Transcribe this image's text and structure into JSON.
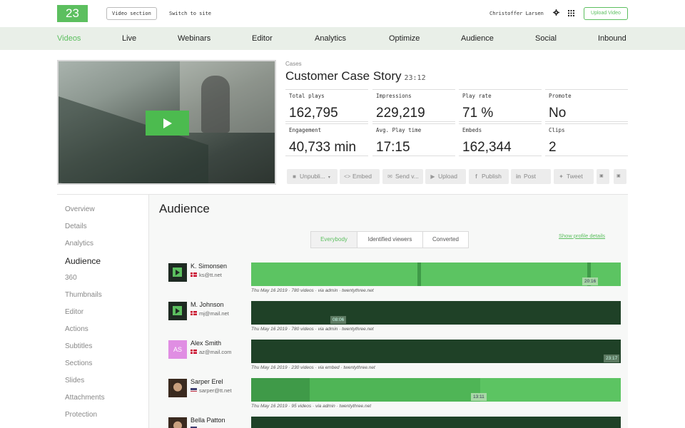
{
  "header": {
    "logo": "23",
    "video_section_label": "Video section",
    "switch_label": "Switch to site",
    "user_name": "Christoffer Larsen",
    "upload_label": "Upload Video"
  },
  "nav": {
    "items": [
      "Videos",
      "Live",
      "Webinars",
      "Editor",
      "Analytics",
      "Optimize",
      "Audience",
      "Social",
      "Inbound"
    ],
    "active": "Videos"
  },
  "video": {
    "category": "Cases",
    "title": "Customer Case Story",
    "duration": "23:12"
  },
  "stats": [
    {
      "label": "Total plays",
      "value": "162,795"
    },
    {
      "label": "Impressions",
      "value": "229,219"
    },
    {
      "label": "Play rate",
      "value": "71 %"
    },
    {
      "label": "Promote",
      "value": "No"
    },
    {
      "label": "Engagement",
      "value": "40,733 min"
    },
    {
      "label": "Avg. Play time",
      "value": "17:15"
    },
    {
      "label": "Embeds",
      "value": "162,344"
    },
    {
      "label": "Clips",
      "value": "2"
    }
  ],
  "actions": [
    {
      "label": "Unpubli...",
      "icon": "lock-icon"
    },
    {
      "label": "Embed",
      "icon": "code-icon"
    },
    {
      "label": "Send v...",
      "icon": "mail-icon"
    },
    {
      "label": "Upload",
      "icon": "youtube-icon"
    },
    {
      "label": "Publish",
      "icon": "facebook-icon"
    },
    {
      "label": "Post",
      "icon": "linkedin-icon"
    },
    {
      "label": "Tweet",
      "icon": "twitter-icon"
    },
    {
      "label": "",
      "icon": "small-23-icon"
    },
    {
      "label": "",
      "icon": "small-23-icon"
    }
  ],
  "sidebar": {
    "items": [
      "Overview",
      "Details",
      "Analytics",
      "Audience",
      "360",
      "Thumbnails",
      "Editor",
      "Actions",
      "Subtitles",
      "Sections",
      "Slides",
      "Attachments",
      "Protection"
    ],
    "active": "Audience"
  },
  "audience": {
    "title": "Audience",
    "filters": [
      "Everybody",
      "Identified viewers",
      "Converted"
    ],
    "active_filter": "Everybody",
    "profile_link": "Show profile details",
    "viewers": [
      {
        "name": "K. Simonsen",
        "email": "ks@tt.net",
        "flag": "dk",
        "avatar": "logo",
        "time_tag": "20:16",
        "meta": "Thu May 16 2019 · 780 videos · via admin · twentythree.net"
      },
      {
        "name": "M. Johnson",
        "email": "mj@mail.net",
        "flag": "dk",
        "avatar": "logo",
        "time_tag": "08:06",
        "meta": "Thu May 16 2019 · 780 videos · via admin · twentythree.net"
      },
      {
        "name": "Alex Smith",
        "email": "az@mail.com",
        "flag": "dk",
        "avatar": "AS",
        "time_tag": "23:17",
        "meta": "Thu May 16 2019 · 230 videos · via embed · twentythree.net"
      },
      {
        "name": "Sarper Erel",
        "email": "sarper@tt.net",
        "flag": "us",
        "avatar": "photo",
        "time_tag": "13:11",
        "meta": "Thu May 16 2019 · 95 videos · via admin · twentythree.net"
      },
      {
        "name": "Bella Patton",
        "email": "",
        "flag": "us",
        "avatar": "photo",
        "time_tag": "",
        "meta": ""
      }
    ]
  },
  "colors": {
    "brand_green": "#5cbf5f",
    "dark_green": "#1f4127",
    "mid_green": "#3f9a48",
    "nav_bg": "#e9efe8"
  }
}
